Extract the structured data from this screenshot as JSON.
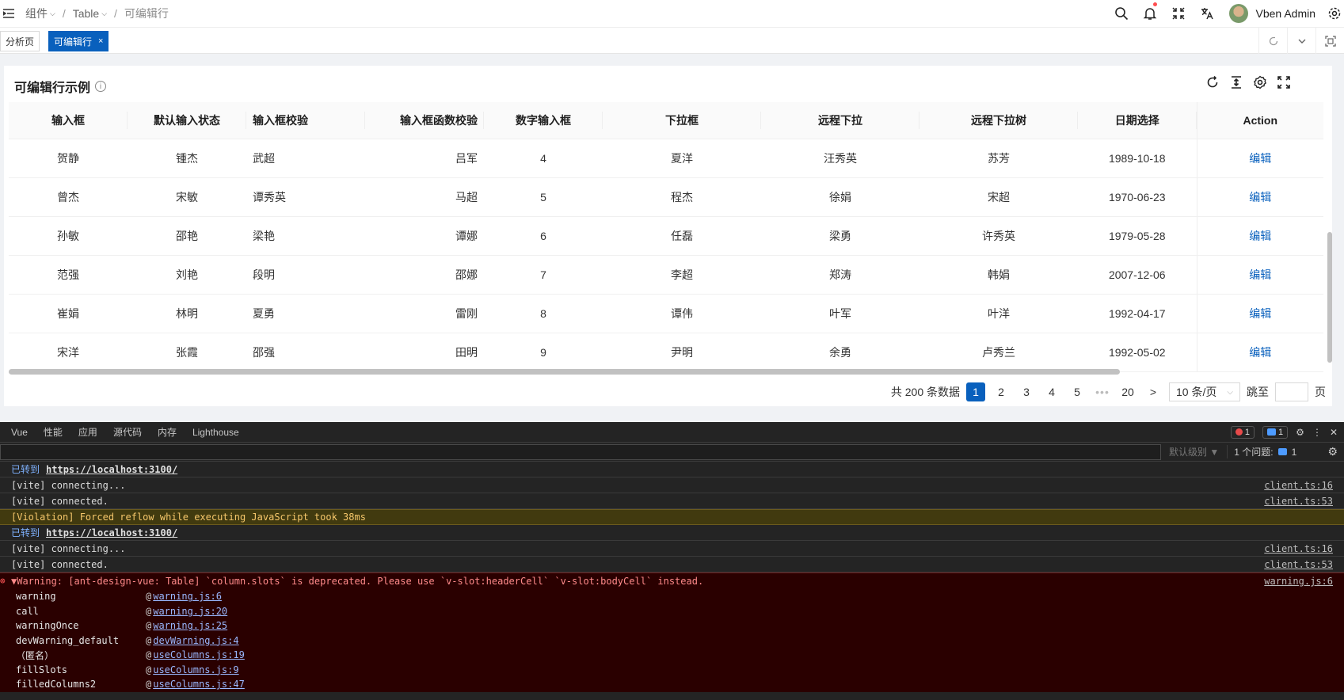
{
  "breadcrumb": [
    "组件",
    "Table",
    "可编辑行"
  ],
  "header": {
    "user_name": "Vben Admin"
  },
  "tabs": [
    {
      "label": "分析页",
      "active": false
    },
    {
      "label": "可编辑行",
      "active": true,
      "close": "×"
    }
  ],
  "card": {
    "title": "可编辑行示例",
    "info_icon": "i"
  },
  "table": {
    "columns": [
      "输入框",
      "默认输入状态",
      "输入框校验",
      "输入框函数校验",
      "数字输入框",
      "下拉框",
      "远程下拉",
      "远程下拉树",
      "日期选择",
      "Action"
    ],
    "rows": [
      [
        "贺静",
        "锺杰",
        "武超",
        "吕军",
        "4",
        "夏洋",
        "汪秀英",
        "苏芳",
        "1989-10-18",
        "编辑"
      ],
      [
        "曾杰",
        "宋敏",
        "谭秀英",
        "马超",
        "5",
        "程杰",
        "徐娟",
        "宋超",
        "1970-06-23",
        "编辑"
      ],
      [
        "孙敏",
        "邵艳",
        "梁艳",
        "谭娜",
        "6",
        "任磊",
        "梁勇",
        "许秀英",
        "1979-05-28",
        "编辑"
      ],
      [
        "范强",
        "刘艳",
        "段明",
        "邵娜",
        "7",
        "李超",
        "郑涛",
        "韩娟",
        "2007-12-06",
        "编辑"
      ],
      [
        "崔娟",
        "林明",
        "夏勇",
        "雷刚",
        "8",
        "谭伟",
        "叶军",
        "叶洋",
        "1992-04-17",
        "编辑"
      ],
      [
        "宋洋",
        "张霞",
        "邵强",
        "田明",
        "9",
        "尹明",
        "余勇",
        "卢秀兰",
        "1992-05-02",
        "编辑"
      ]
    ]
  },
  "pagination": {
    "total_text": "共 200 条数据",
    "pages": [
      "1",
      "2",
      "3",
      "4",
      "5"
    ],
    "ellipsis": "•••",
    "last_page": "20",
    "next": ">",
    "page_size": "10 条/页",
    "jump_label": "跳至",
    "page_suffix": "页",
    "current": 1
  },
  "devtools": {
    "tabs": [
      "Vue",
      "性能",
      "应用",
      "源代码",
      "内存",
      "Lighthouse"
    ],
    "error_count": "1",
    "message_count": "1",
    "level_select": "默认级别 ▼",
    "issues_label": "1 个问题:",
    "issues_count": "1",
    "logs": [
      {
        "type": "nav",
        "label": "已转到",
        "url": "https://localhost:3100/"
      },
      {
        "type": "log",
        "text": "[vite] connecting...",
        "src": "client.ts:16"
      },
      {
        "type": "log",
        "text": "[vite] connected.",
        "src": "client.ts:53"
      },
      {
        "type": "violation",
        "text": "[Violation] Forced reflow while executing JavaScript took 38ms"
      },
      {
        "type": "nav",
        "label": "已转到",
        "url": "https://localhost:3100/"
      },
      {
        "type": "log",
        "text": "[vite] connecting...",
        "src": "client.ts:16"
      },
      {
        "type": "log",
        "text": "[vite] connected.",
        "src": "client.ts:53"
      }
    ],
    "error": {
      "message": "▼Warning: [ant-design-vue: Table] `column.slots` is deprecated. Please use `v-slot:headerCell` `v-slot:bodyCell` instead.",
      "src": "warning.js:6",
      "stack": [
        {
          "fn": "warning",
          "loc": "warning.js:6"
        },
        {
          "fn": "call",
          "loc": "warning.js:20"
        },
        {
          "fn": "warningOnce",
          "loc": "warning.js:25"
        },
        {
          "fn": "devWarning_default",
          "loc": "devWarning.js:4"
        },
        {
          "fn": "（匿名）",
          "loc": "useColumns.js:19"
        },
        {
          "fn": "fillSlots",
          "loc": "useColumns.js:9"
        },
        {
          "fn": "filledColumns2",
          "loc": "useColumns.js:47"
        }
      ]
    }
  }
}
